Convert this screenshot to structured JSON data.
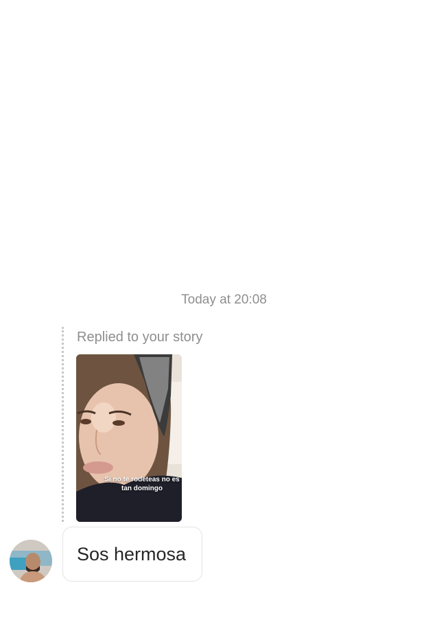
{
  "conversation": {
    "timestamp": "Today at 20:08",
    "story_reply": {
      "caption": "Replied to your story",
      "story_overlay_text": "Si no te rodeteas no es tan domingo"
    },
    "message": {
      "text": "Sos hermosa"
    }
  },
  "colors": {
    "meta_text": "#8e8e8e",
    "message_text": "#262626",
    "bubble_border": "#e3e3e3"
  },
  "icons": {
    "avatar": "sender-avatar-photo",
    "story": "story-thumbnail-photo"
  }
}
